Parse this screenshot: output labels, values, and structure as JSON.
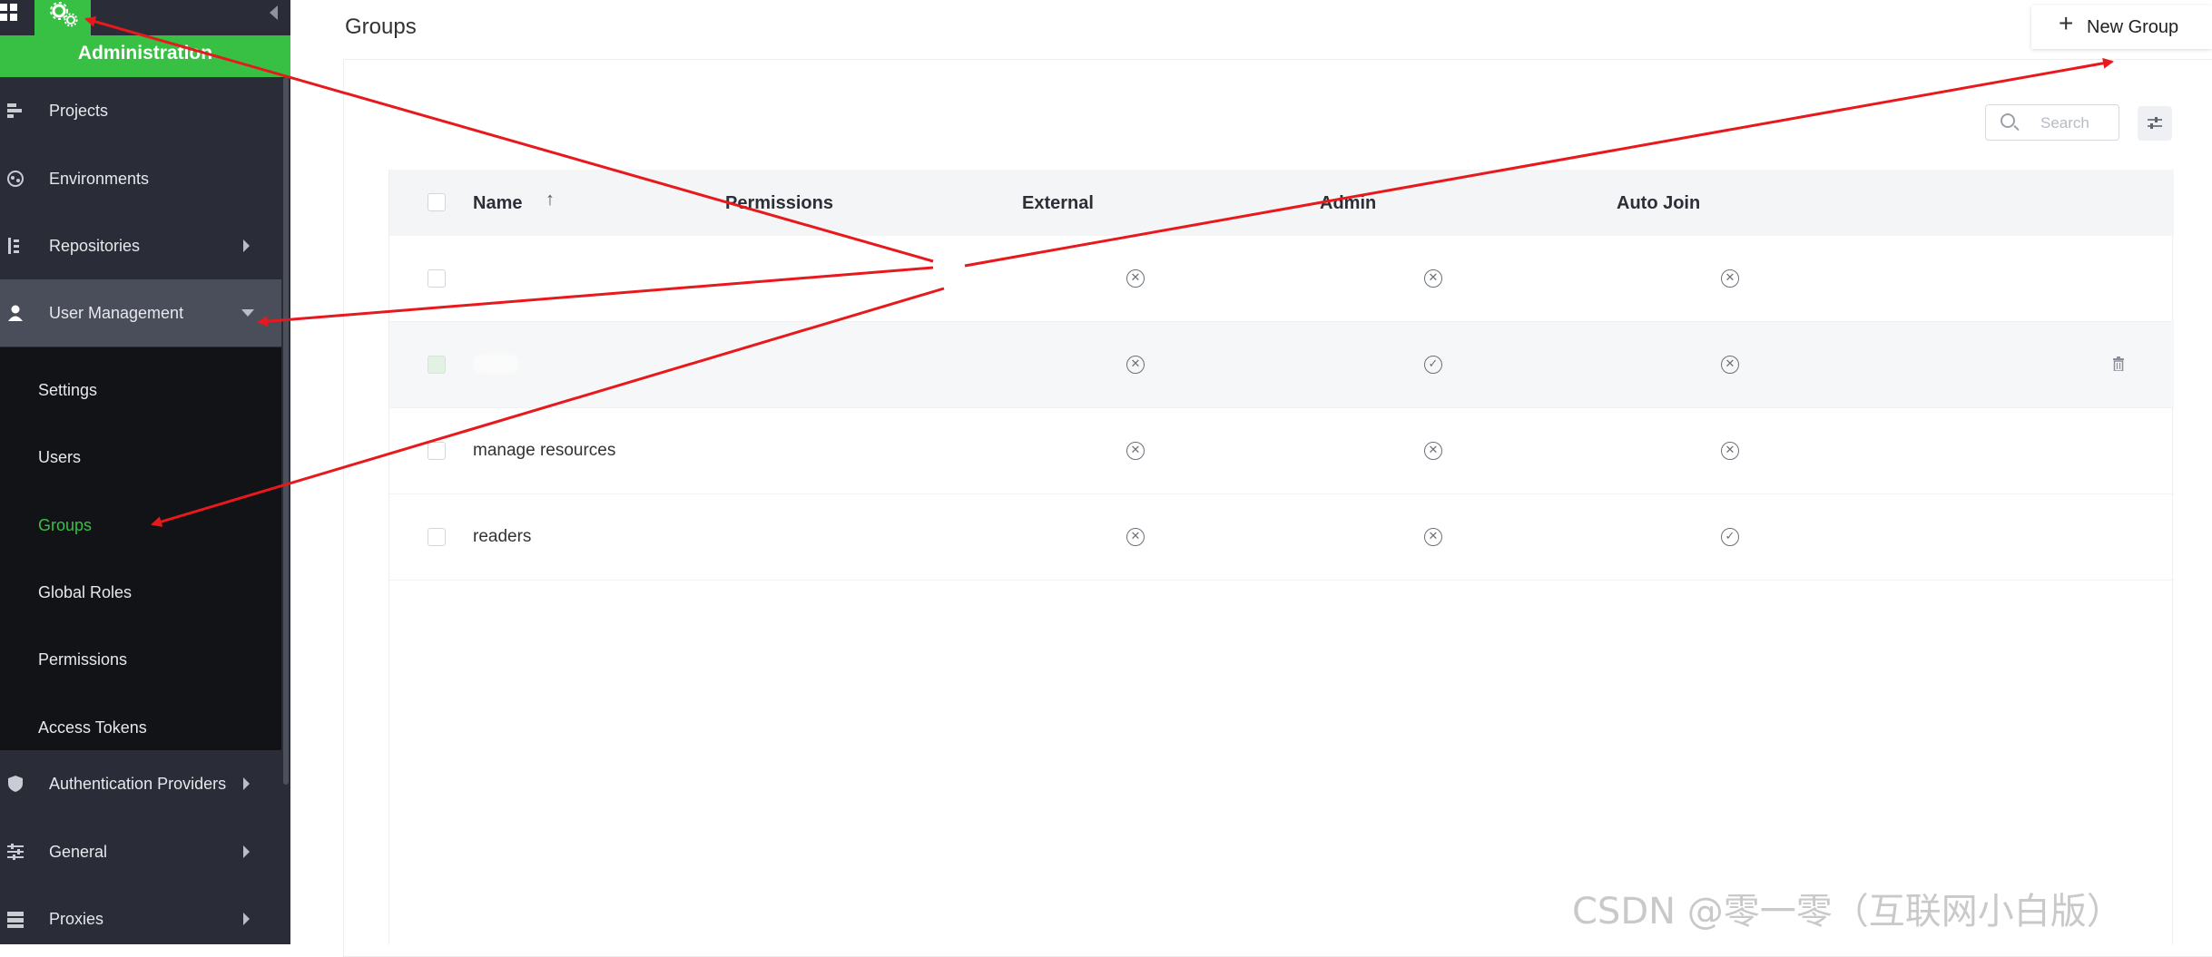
{
  "sidebar": {
    "header": "Administration",
    "items": [
      {
        "label": "Projects",
        "icon": "projects-icon"
      },
      {
        "label": "Environments",
        "icon": "environments-icon"
      },
      {
        "label": "Repositories",
        "icon": "repositories-icon"
      },
      {
        "label": "User Management",
        "icon": "user-icon"
      },
      {
        "label": "Authentication Providers",
        "icon": "shield-icon"
      },
      {
        "label": "General",
        "icon": "sliders-icon"
      },
      {
        "label": "Proxies",
        "icon": "server-icon"
      }
    ],
    "user_management_subitems": [
      {
        "label": "Settings"
      },
      {
        "label": "Users"
      },
      {
        "label": "Groups"
      },
      {
        "label": "Global Roles"
      },
      {
        "label": "Permissions"
      },
      {
        "label": "Access Tokens"
      }
    ],
    "selected_subitem": "Groups"
  },
  "main": {
    "title": "Groups",
    "new_group_label": "New Group",
    "search_placeholder": "Search"
  },
  "table": {
    "columns": [
      "Name",
      "Permissions",
      "External",
      "Admin",
      "Auto Join"
    ],
    "sort_column": "Name",
    "sort_direction": "ascending",
    "rows": [
      {
        "name": "",
        "external": "no",
        "admin": "no",
        "auto_join": "no"
      },
      {
        "name": "",
        "external": "no",
        "admin": "yes",
        "auto_join": "no",
        "highlighted": true
      },
      {
        "name": "manage resources",
        "external": "no",
        "admin": "no",
        "auto_join": "no"
      },
      {
        "name": "readers",
        "external": "no",
        "admin": "no",
        "auto_join": "yes"
      }
    ]
  },
  "watermark": "CSDN @零一零（互联网小白版）",
  "colors": {
    "accent": "#37c044",
    "sidebar_bg": "#2a2d37",
    "submenu_bg": "#111316",
    "annotation_arrow": "#e8191c"
  }
}
